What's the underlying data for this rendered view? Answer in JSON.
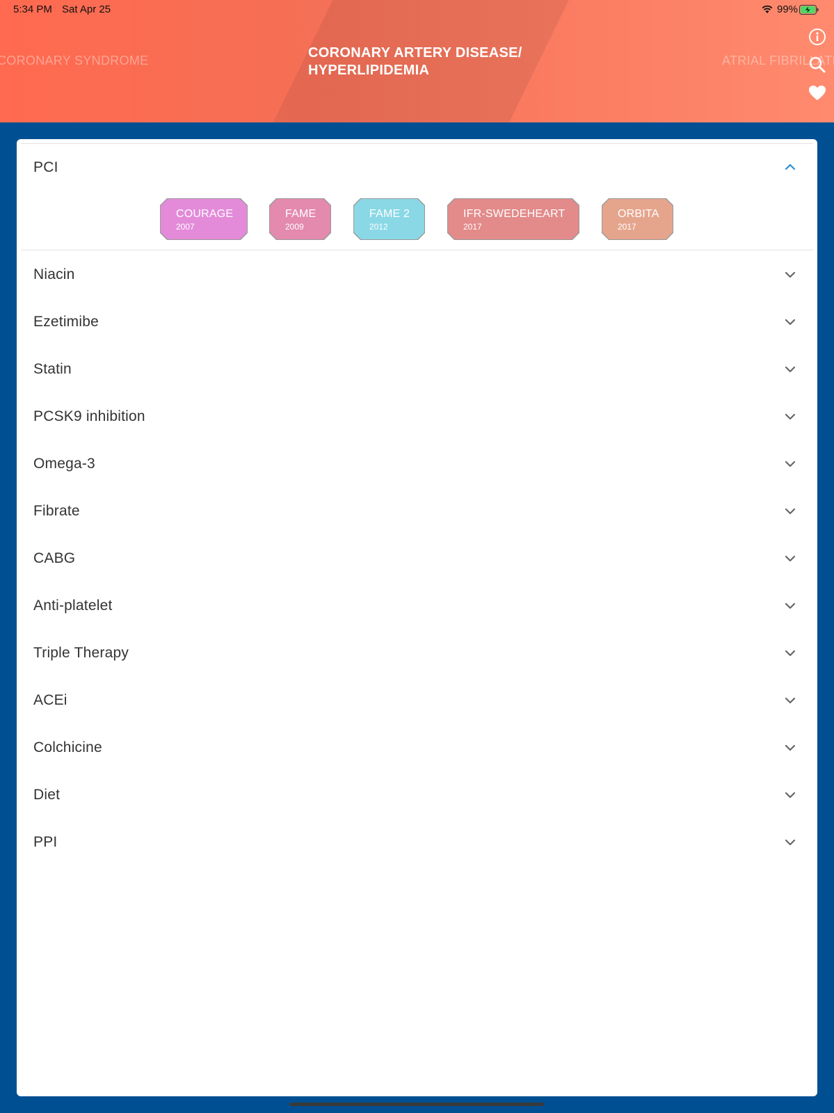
{
  "status_bar": {
    "time": "5:34 PM",
    "date": "Sat Apr 25",
    "battery": "99%"
  },
  "header": {
    "prev_topic": "CORONARY SYNDROME",
    "title_line1": "CORONARY ARTERY DISEASE/",
    "title_line2": "HYPERLIPIDEMIA",
    "next_topic": "ATRIAL FIBRILLATI",
    "icons": [
      "info-icon",
      "search-icon",
      "heart-icon"
    ]
  },
  "expanded_section": {
    "label": "PCI",
    "trials": [
      {
        "name": "COURAGE",
        "year": "2007",
        "color": "#e38bd9"
      },
      {
        "name": "FAME",
        "year": "2009",
        "color": "#e38aae"
      },
      {
        "name": "FAME 2",
        "year": "2012",
        "color": "#8ad8e6"
      },
      {
        "name": "IFR-SWEDEHEART",
        "year": "2017",
        "color": "#e38a8a"
      },
      {
        "name": "ORBITA",
        "year": "2017",
        "color": "#e5a58d"
      }
    ]
  },
  "sections": [
    {
      "label": "Niacin"
    },
    {
      "label": "Ezetimibe"
    },
    {
      "label": "Statin"
    },
    {
      "label": "PCSK9 inhibition"
    },
    {
      "label": "Omega-3"
    },
    {
      "label": "Fibrate"
    },
    {
      "label": "CABG"
    },
    {
      "label": "Anti-platelet"
    },
    {
      "label": "Triple Therapy"
    },
    {
      "label": "ACEi"
    },
    {
      "label": "Colchicine"
    },
    {
      "label": "Diet"
    },
    {
      "label": "PPI"
    }
  ],
  "colors": {
    "background": "#004f93",
    "accent_chevron_up": "#2a8fd6",
    "chevron_down": "#666666"
  }
}
